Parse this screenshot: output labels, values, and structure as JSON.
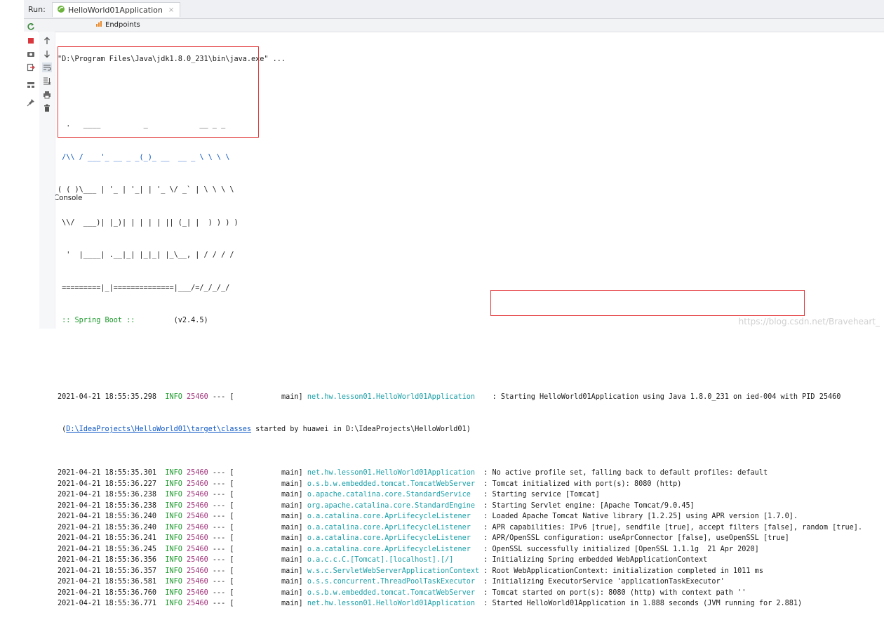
{
  "run_bar": {
    "label": "Run:",
    "tab_title": "HelloWorld01Application",
    "tab_close": "×"
  },
  "console_tabs": [
    {
      "label": "Console"
    },
    {
      "label": "Endpoints"
    }
  ],
  "icons": {
    "left_toolbar": [
      "rerun-icon",
      "stop-icon",
      "camera-icon",
      "exit-icon",
      "layout-icon",
      "pin-icon"
    ],
    "right_toolbar": [
      "up-arrow-icon",
      "down-arrow-icon",
      "soft-wrap-icon",
      "scroll-to-end-icon",
      "print-icon",
      "trash-icon"
    ]
  },
  "console": {
    "command": "\"D:\\Program Files\\Java\\jdk1.8.0_231\\bin\\java.exe\" ...",
    "banner": [
      "  .   ____          _            __ _ _",
      " /\\\\ / ___'_ __ _ _(_)_ __  __ _ \\ \\ \\ \\",
      "( ( )\\___ | '_ | '_| | '_ \\/ _` | \\ \\ \\ \\",
      " \\\\/  ___)| |_)| | | | | || (_| |  ) ) ) )",
      "  '  |____| .__|_| |_|_| |_\\__, | / / / /",
      " =========|_|==============|___/=/_/_/_/"
    ],
    "spring_label": " :: Spring Boot ::",
    "spring_version": "(v2.4.5)",
    "first_log": {
      "timestamp": "2021-04-21 18:55:35.298",
      "level": "INFO",
      "pid": "25460",
      "sep": "--- [",
      "thread": "main]",
      "logger": "net.hw.lesson01.HelloWorld01Application",
      "message": ": Starting HelloWorld01Application using Java 1.8.0_231 on ied-004 with PID 25460"
    },
    "cont_prefix": "(",
    "cont_link": "D:\\IdeaProjects\\HelloWorld01\\target\\classes",
    "cont_suffix": " started by huawei in D:\\IdeaProjects\\HelloWorld01)",
    "logs": [
      {
        "timestamp": "2021-04-21 18:55:35.301",
        "level": "INFO",
        "pid": "25460",
        "sep": "--- [",
        "thread": "main]",
        "logger": "net.hw.lesson01.HelloWorld01Application",
        "message": ": No active profile set, falling back to default profiles: default"
      },
      {
        "timestamp": "2021-04-21 18:55:36.227",
        "level": "INFO",
        "pid": "25460",
        "sep": "--- [",
        "thread": "main]",
        "logger": "o.s.b.w.embedded.tomcat.TomcatWebServer",
        "message": ": Tomcat initialized with port(s): 8080 (http)"
      },
      {
        "timestamp": "2021-04-21 18:55:36.238",
        "level": "INFO",
        "pid": "25460",
        "sep": "--- [",
        "thread": "main]",
        "logger": "o.apache.catalina.core.StandardService",
        "message": ": Starting service [Tomcat]"
      },
      {
        "timestamp": "2021-04-21 18:55:36.238",
        "level": "INFO",
        "pid": "25460",
        "sep": "--- [",
        "thread": "main]",
        "logger": "org.apache.catalina.core.StandardEngine",
        "message": ": Starting Servlet engine: [Apache Tomcat/9.0.45]"
      },
      {
        "timestamp": "2021-04-21 18:55:36.240",
        "level": "INFO",
        "pid": "25460",
        "sep": "--- [",
        "thread": "main]",
        "logger": "o.a.catalina.core.AprLifecycleListener",
        "message": ": Loaded Apache Tomcat Native library [1.2.25] using APR version [1.7.0]."
      },
      {
        "timestamp": "2021-04-21 18:55:36.240",
        "level": "INFO",
        "pid": "25460",
        "sep": "--- [",
        "thread": "main]",
        "logger": "o.a.catalina.core.AprLifecycleListener",
        "message": ": APR capabilities: IPv6 [true], sendfile [true], accept filters [false], random [true]."
      },
      {
        "timestamp": "2021-04-21 18:55:36.241",
        "level": "INFO",
        "pid": "25460",
        "sep": "--- [",
        "thread": "main]",
        "logger": "o.a.catalina.core.AprLifecycleListener",
        "message": ": APR/OpenSSL configuration: useAprConnector [false], useOpenSSL [true]"
      },
      {
        "timestamp": "2021-04-21 18:55:36.245",
        "level": "INFO",
        "pid": "25460",
        "sep": "--- [",
        "thread": "main]",
        "logger": "o.a.catalina.core.AprLifecycleListener",
        "message": ": OpenSSL successfully initialized [OpenSSL 1.1.1g  21 Apr 2020]"
      },
      {
        "timestamp": "2021-04-21 18:55:36.356",
        "level": "INFO",
        "pid": "25460",
        "sep": "--- [",
        "thread": "main]",
        "logger": "o.a.c.c.C.[Tomcat].[localhost].[/]",
        "message": ": Initializing Spring embedded WebApplicationContext"
      },
      {
        "timestamp": "2021-04-21 18:55:36.357",
        "level": "INFO",
        "pid": "25460",
        "sep": "--- [",
        "thread": "main]",
        "logger": "w.s.c.ServletWebServerApplicationContext",
        "message": ": Root WebApplicationContext: initialization completed in 1011 ms"
      },
      {
        "timestamp": "2021-04-21 18:55:36.581",
        "level": "INFO",
        "pid": "25460",
        "sep": "--- [",
        "thread": "main]",
        "logger": "o.s.s.concurrent.ThreadPoolTaskExecutor",
        "message": ": Initializing ExecutorService 'applicationTaskExecutor'"
      },
      {
        "timestamp": "2021-04-21 18:55:36.760",
        "level": "INFO",
        "pid": "25460",
        "sep": "--- [",
        "thread": "main]",
        "logger": "o.s.b.w.embedded.tomcat.TomcatWebServer",
        "message": ": Tomcat started on port(s): 8080 (http) with context path ''"
      },
      {
        "timestamp": "2021-04-21 18:55:36.771",
        "level": "INFO",
        "pid": "25460",
        "sep": "--- [",
        "thread": "main]",
        "logger": "net.hw.lesson01.HelloWorld01Application",
        "message": ": Started HelloWorld01Application in 1.888 seconds (JVM running for 2.881)"
      }
    ]
  },
  "colors": {
    "info": "#1a9a2a",
    "pid": "#a0327a",
    "logger": "#1ba0a8",
    "link": "#0b56c5",
    "highlight_border": "#e2383a"
  },
  "watermark": "https://blog.csdn.net/Braveheart_"
}
